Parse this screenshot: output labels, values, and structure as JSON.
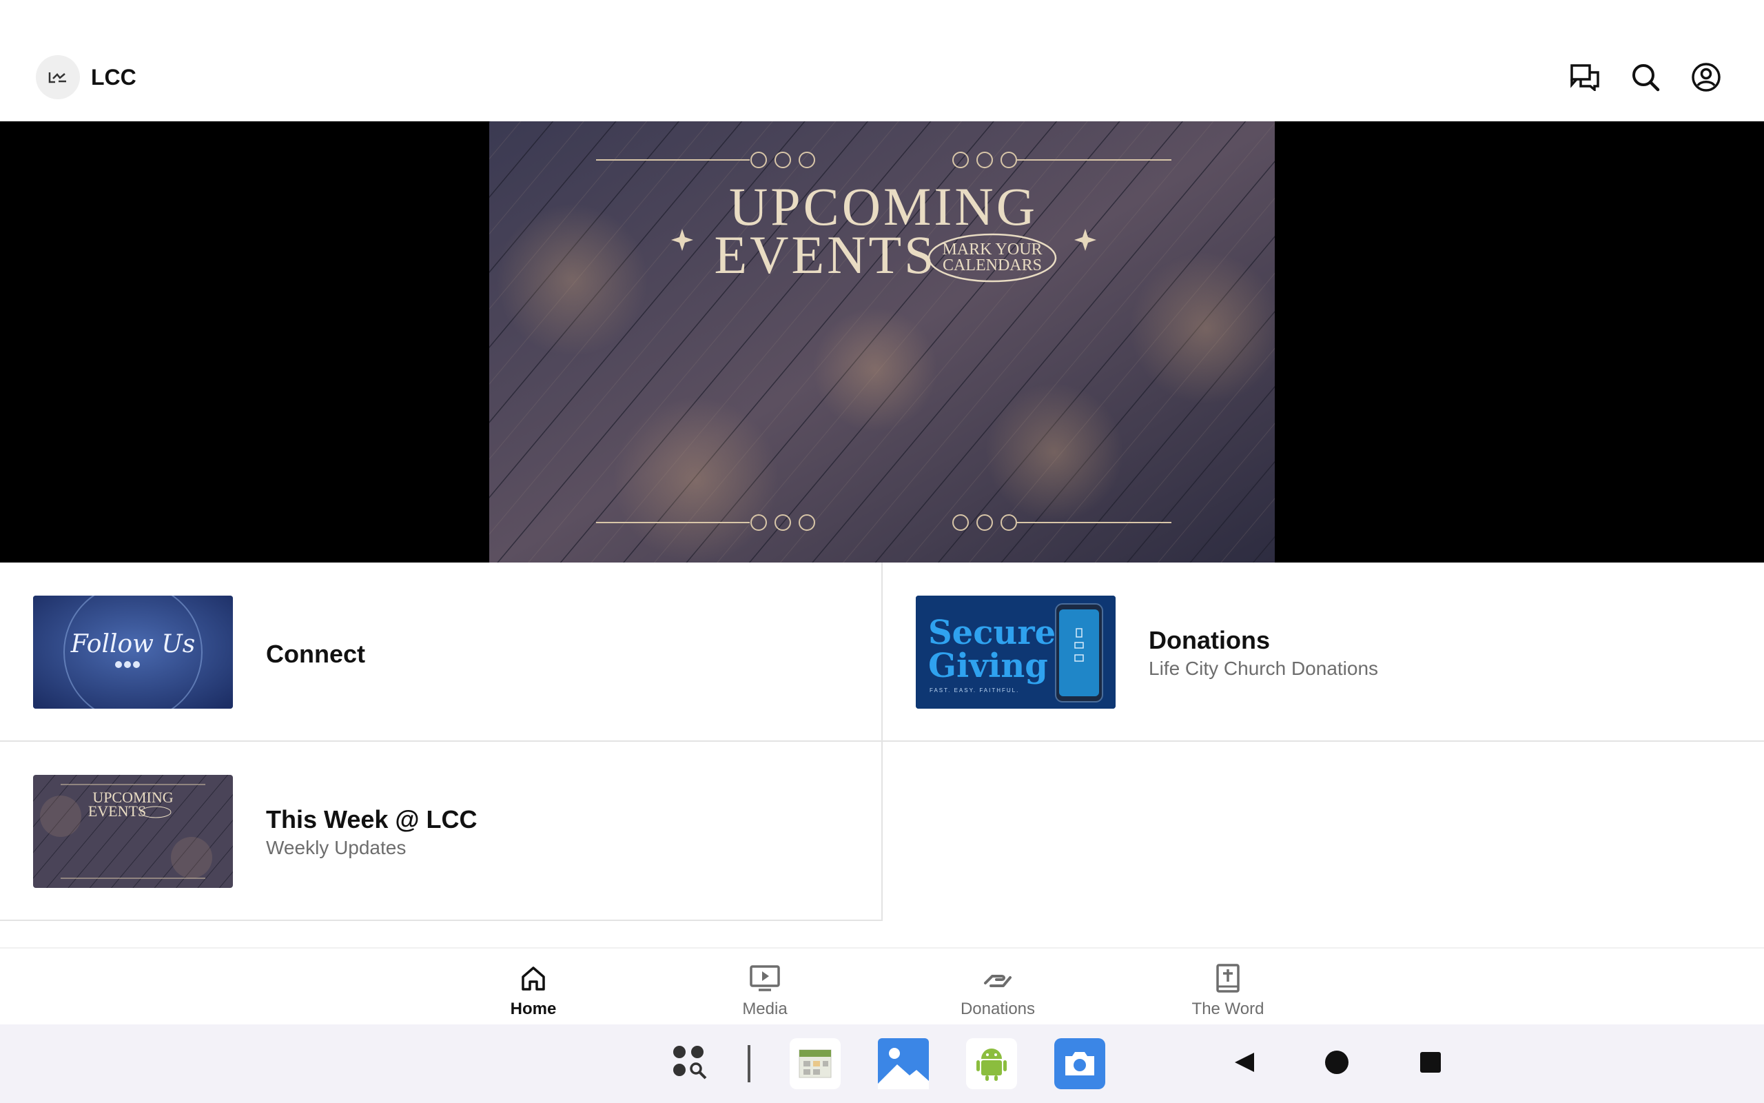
{
  "header": {
    "app_title": "LCC",
    "logo_icon": "lcc-logo-icon",
    "actions": [
      "chat-icon",
      "search-icon",
      "account-icon"
    ]
  },
  "hero": {
    "title_line1": "UPCOMING",
    "title_line2": "EVENTS",
    "badge_line1": "MARK YOUR",
    "badge_line2": "CALENDARS"
  },
  "tiles": [
    {
      "title": "Connect",
      "subtitle": "",
      "thumb_text": "Follow Us"
    },
    {
      "title": "Donations",
      "subtitle": "Life City Church Donations",
      "thumb_line1": "Secure",
      "thumb_line2": "Giving",
      "thumb_tagline": "FAST. EASY. FAITHFUL."
    },
    {
      "title": "This Week @ LCC",
      "subtitle": "Weekly Updates",
      "thumb_line1": "UPCOMING",
      "thumb_line2": "EVENTS"
    }
  ],
  "bottom_nav": [
    {
      "label": "Home",
      "icon": "home-icon",
      "active": true
    },
    {
      "label": "Media",
      "icon": "media-icon",
      "active": false
    },
    {
      "label": "Donations",
      "icon": "donations-icon",
      "active": false
    },
    {
      "label": "The Word",
      "icon": "bible-icon",
      "active": false
    }
  ],
  "system_bar": {
    "apps": [
      "app-drawer-icon",
      "calendar-app-icon",
      "gallery-app-icon",
      "android-app-icon",
      "camera-app-icon"
    ],
    "nav": [
      "back-icon",
      "home-circle-icon",
      "recents-icon"
    ]
  },
  "colors": {
    "accent_text": "#111111",
    "muted_text": "#6d6d6d",
    "hero_bg": "#000000",
    "giving_blue": "#1f8fe0"
  }
}
